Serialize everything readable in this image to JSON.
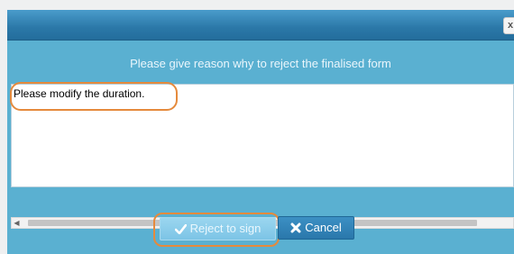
{
  "dialog": {
    "title": "",
    "close_label": "x",
    "prompt": "Please give reason why to reject the finalised form",
    "reason_value": "Please modify the duration.",
    "buttons": {
      "reject_label": "Reject to sign",
      "cancel_label": "Cancel"
    }
  },
  "icons": {
    "reject": "check-icon",
    "cancel": "x-icon",
    "scroll_left": "arrow-left-icon"
  },
  "colors": {
    "dialog_bg": "#5ab0d1",
    "titlebar": "#2b78a8",
    "highlight": "#e58a3c",
    "reject_button": "#8ccde9",
    "cancel_button": "#2f80b5"
  }
}
